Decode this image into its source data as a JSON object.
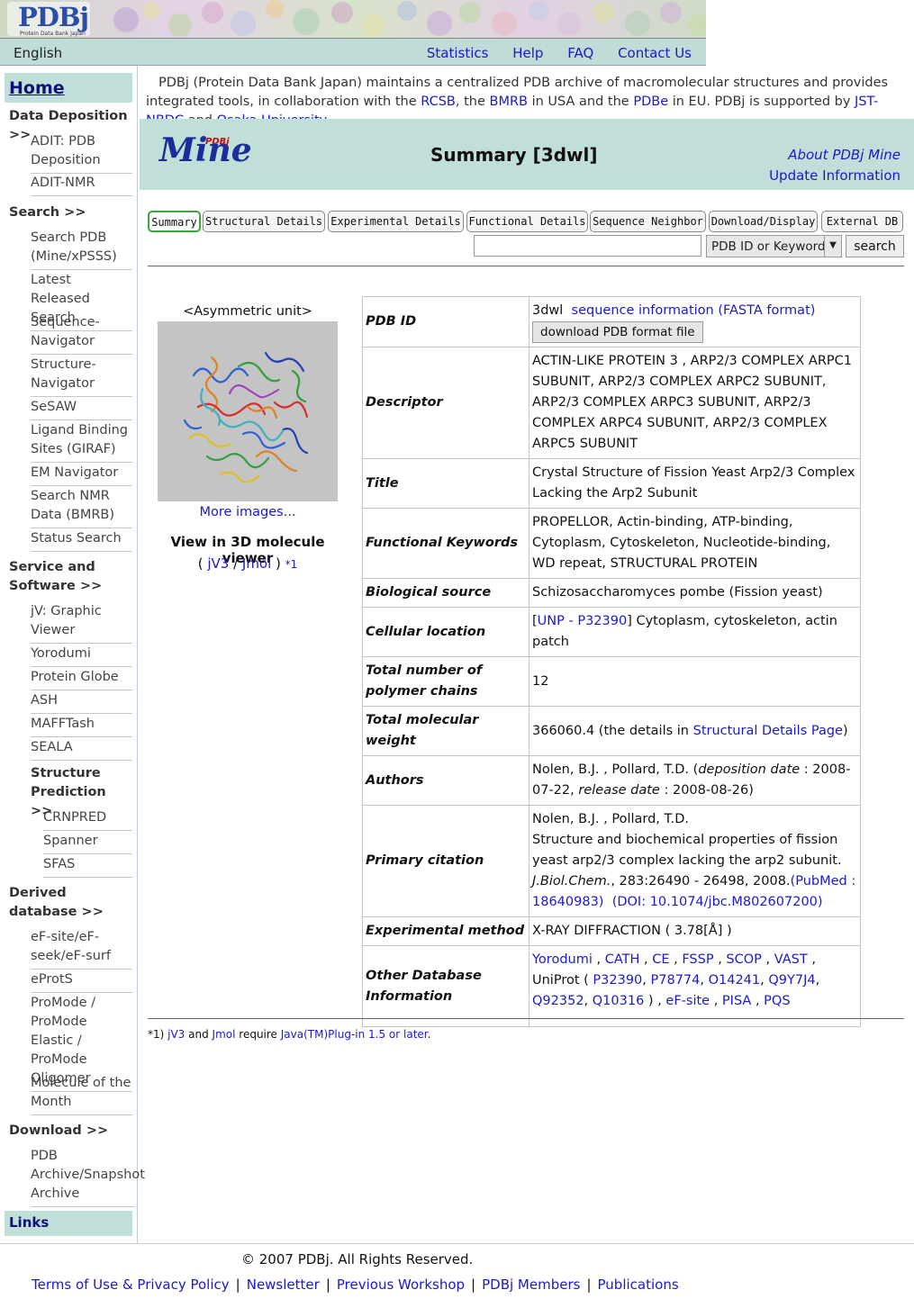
{
  "banner": {
    "logo_text": "PDBj",
    "logo_sub": "Protein Data Bank Japan"
  },
  "topnav": {
    "language": "English",
    "links": [
      "Statistics",
      "Help",
      "FAQ",
      "Contact Us"
    ]
  },
  "sidebar": {
    "home": "Home",
    "sections": {
      "deposition": "Data Deposition >>",
      "search": "Search >>",
      "service": "Service and Software >>",
      "structure_prediction": "Structure Prediction >>",
      "derived": "Derived database >>",
      "download": "Download >>"
    },
    "deposition_items": [
      "ADIT: PDB Deposition",
      "ADIT-NMR"
    ],
    "search_items": [
      "Search PDB (Mine/xPSSS)",
      "Latest Released Search",
      "Sequence-Navigator",
      "Structure-Navigator",
      "SeSAW",
      "Ligand Binding Sites (GIRAF)",
      "EM Navigator",
      "Search NMR Data (BMRB)",
      "Status Search"
    ],
    "service_items": [
      "jV: Graphic Viewer",
      "Yorodumi",
      "Protein Globe",
      "ASH",
      "MAFFTash",
      "SEALA"
    ],
    "prediction_items": [
      "CRNPRED",
      "Spanner",
      "SFAS"
    ],
    "derived_items": [
      "eF-site/eF-seek/eF-surf",
      "eProtS",
      "ProMode / ProMode Elastic / ProMode Oligomer",
      "Molecule of the Month"
    ],
    "download_items": [
      "PDB Archive/Snapshot Archive"
    ],
    "links": "Links"
  },
  "intro": {
    "t1": "PDBj (Protein Data Bank Japan) maintains a centralized PDB archive of macromolecular structures and provides integrated tools, in collaboration with the ",
    "rcsb": "RCSB",
    "t2": ", the ",
    "bmrb": "BMRB",
    "t3": " in USA and the ",
    "pdbe": "PDBe",
    "t4": " in EU. PDBj is supported by ",
    "jst": "JST-NBDC",
    "t5": " and ",
    "osaka": "Osaka University",
    "t6": "."
  },
  "mine": {
    "logo": "Mine",
    "logo_pdbj": "PDBj",
    "title": "Summary [3dwl]",
    "about": "About PDBj Mine",
    "update": "Update Information"
  },
  "tabs": [
    "Summary",
    "Structural Details",
    "Experimental Details",
    "Functional Details",
    "Sequence Neighbor",
    "Download/Display",
    "External DB"
  ],
  "search": {
    "input_value": "",
    "select_value": "PDB ID or Keyword",
    "button": "search"
  },
  "image_panel": {
    "caption": "<Asymmetric unit>",
    "more": "More images...",
    "viewer_label": "View in 3D molecule viewer",
    "open": "( ",
    "jv3": "jV3",
    "slash": " / ",
    "jmol": "Jmol",
    "close": " ) ",
    "note": "*1"
  },
  "info": {
    "pdb_id": {
      "key": "PDB ID",
      "id": "3dwl",
      "seq_link": "sequence information (FASTA format)",
      "download": "download PDB format file"
    },
    "descriptor": {
      "key": "Descriptor",
      "value": "ACTIN-LIKE PROTEIN 3 , ARP2/3 COMPLEX ARPC1 SUBUNIT, ARP2/3 COMPLEX ARPC2 SUBUNIT, ARP2/3 COMPLEX ARPC3 SUBUNIT, ARP2/3 COMPLEX ARPC4 SUBUNIT, ARP2/3 COMPLEX ARPC5 SUBUNIT"
    },
    "title": {
      "key": "Title",
      "value": "Crystal Structure of Fission Yeast Arp2/3 Complex Lacking the Arp2 Subunit"
    },
    "keywords": {
      "key": "Functional Keywords",
      "value": "PROPELLOR, Actin-binding, ATP-binding, Cytoplasm, Cytoskeleton, Nucleotide-binding, WD repeat, STRUCTURAL PROTEIN"
    },
    "source": {
      "key": "Biological source",
      "value": "Schizosaccharomyces pombe (Fission yeast)"
    },
    "location": {
      "key": "Cellular location",
      "open": "[",
      "link": "UNP - P32390",
      "text": "] Cytoplasm, cytoskeleton, actin patch"
    },
    "chains": {
      "key": "Total number of polymer chains",
      "value": "12"
    },
    "weight": {
      "key": "Total molecular weight",
      "value": "366060.4 (the details in ",
      "link": "Structural Details Page",
      "close": ")"
    },
    "authors": {
      "key": "Authors",
      "names": "Nolen, B.J. , Pollard, T.D. (",
      "dep_label": "deposition date",
      "dep": " : 2008-07-22, ",
      "rel_label": "release date",
      "rel": " : 2008-08-26)"
    },
    "citation": {
      "key": "Primary citation",
      "authors": "Nolen, B.J. , Pollard, T.D.",
      "title": "Structure and biochemical properties of fission yeast arp2/3 complex lacking the arp2 subunit.",
      "journal": "J.Biol.Chem.",
      "ref": ", 283:26490 - 26498, 2008.",
      "pubmed": "(PubMed : 18640983)",
      "doi": "(DOI: 10.1074/jbc.M802607200)"
    },
    "method": {
      "key": "Experimental method",
      "value": "X-RAY DIFFRACTION ( 3.78[Å] )"
    },
    "otherdb": {
      "key": "Other Database Information",
      "yorodumi": "Yorodumi",
      "cath": "CATH",
      "ce": "CE",
      "fssp": "FSSP",
      "scop": "SCOP",
      "vast": "VAST",
      "uniprot": "UniProt ( ",
      "p32390": "P32390",
      "p78774": "P78774",
      "o14241": "O14241",
      "q9y7j4": "Q9Y7J4",
      "q92352": "Q92352",
      "q10316": "Q10316",
      "efsite": "eF-site",
      "pisa": "PISA",
      "pqs": "PQS"
    }
  },
  "footnote": {
    "mark": "*1) ",
    "jv3": "jV3",
    "and": " and ",
    "jmol": "Jmol",
    "req": " require ",
    "java": "Java(TM)Plug-in 1.5 or later",
    "end": "."
  },
  "footer": {
    "copyright": "© 2007 PDBj. All Rights Reserved.",
    "links": [
      "Terms of Use & Privacy Policy",
      "Newsletter",
      "Previous Workshop",
      "PDBj Members",
      "Publications"
    ]
  }
}
